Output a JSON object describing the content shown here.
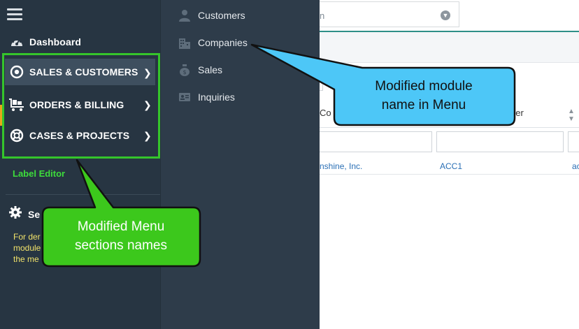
{
  "main": {
    "search_text": "n",
    "table_header": {
      "col1": "Co",
      "col2": "ber"
    },
    "row": {
      "c1": "nshine, Inc.",
      "c2": "ACC1",
      "c3": "ac"
    }
  },
  "nav": {
    "dashboard": "Dashboard",
    "sections": [
      {
        "label": "SALES & CUSTOMERS",
        "icon": "target-icon"
      },
      {
        "label": "ORDERS & BILLING",
        "icon": "cart-icon"
      },
      {
        "label": "CASES & PROJECTS",
        "icon": "lifebuoy-icon"
      }
    ],
    "label_editor": "Label Editor",
    "settings": "Se",
    "note_lines": [
      "For der",
      "module",
      "the me"
    ]
  },
  "submenu": {
    "items": [
      {
        "label": "Customers",
        "icon": "person-icon"
      },
      {
        "label": "Companies",
        "icon": "building-icon"
      },
      {
        "label": "Sales",
        "icon": "money-bag-icon"
      },
      {
        "label": "Inquiries",
        "icon": "id-card-icon"
      }
    ]
  },
  "callouts": {
    "blue": [
      "Modified module",
      "name in Menu"
    ],
    "green": [
      "Modified Menu",
      "sections names"
    ]
  },
  "colors": {
    "nav_bg": "#273542",
    "submenu_bg": "#2e3c4a",
    "highlight_green": "#35c52b",
    "callout_blue": "#4dc7f7",
    "callout_green": "#3cc81c",
    "accent_teal": "#2e8f88"
  }
}
